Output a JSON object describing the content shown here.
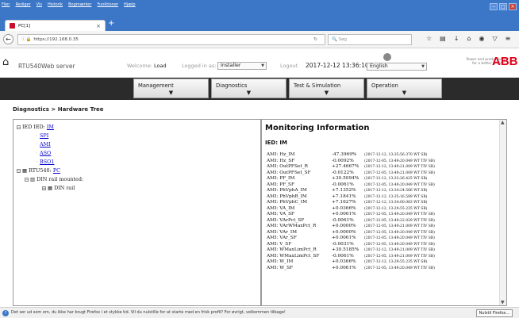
{
  "browser": {
    "menu": [
      "Filer",
      "Rediger",
      "Vis",
      "Historik",
      "Bogmærker",
      "Funktioner",
      "Hjælp"
    ],
    "tab_title": "PC[1]",
    "url": "https://192.168.0.35",
    "search_placeholder": "Søg"
  },
  "app": {
    "title": "RTU540Web server",
    "welcome_label": "Welcome:",
    "welcome_user": "Load",
    "logged_in_label": "Logged in as:",
    "logged_in_value": "Installer",
    "logout_label": "Logout",
    "datetime": "2017-12-12 13:36:10",
    "language": "English",
    "tagline_1": "Power and productivity",
    "tagline_2": "for a better world™",
    "logo": "ABB",
    "brand_color": "#e2001a"
  },
  "menus": [
    {
      "label": "Management"
    },
    {
      "label": "Diagnostics"
    },
    {
      "label": "Test & Simulation"
    },
    {
      "label": "Operation"
    }
  ],
  "breadcrumb": "Diagnostics > Hardware Tree",
  "tree": {
    "ied_prefix": "IED IED:",
    "ied_link": "IM",
    "children": [
      "SPI",
      "AMI",
      "ASO",
      "BSO1"
    ],
    "rtu_prefix": "RTU540:",
    "rtu_link": "PC",
    "din_mounted": "DIN rail mounted:",
    "din_rail": "DIN rail"
  },
  "monitoring": {
    "title": "Monitoring Information",
    "ied_label": "IED: IM",
    "rows": [
      {
        "name": "AMI: Hz_IM",
        "value": "-47.3969%",
        "ts": "(2017-12-12, 13:35:56.370 WT SB)"
      },
      {
        "name": "AMI: Hz_SF",
        "value": "-0.0092%",
        "ts": "(2017-12-05, 13:49:20.049 WT TIV SB)"
      },
      {
        "name": "AMI: OutPFSet_R",
        "value": "+27.4667%",
        "ts": "(2017-12-12, 13:49:21.009 WT TIV SB)"
      },
      {
        "name": "AMI: OutPFSet_SF",
        "value": "-0.0122%",
        "ts": "(2017-12-05, 13:49:21.009 WT TIV SB)"
      },
      {
        "name": "AMI: PF_IM",
        "value": "+30.5094%",
        "ts": "(2017-12-12, 13:33:26.425 WT SB)"
      },
      {
        "name": "AMI: PF_SF",
        "value": "-0.0061%",
        "ts": "(2017-12-05, 13:49:20.049 WT TIV SB)"
      },
      {
        "name": "AMI: PhVphA_IM",
        "value": "+7.1352%",
        "ts": "(2017-12-12, 13:34:24.566 WT SB)"
      },
      {
        "name": "AMI: PhVphB_IM",
        "value": "+7.1841%",
        "ts": "(2017-12-12, 13:35:16.589 WT SB)"
      },
      {
        "name": "AMI: PhVphC_IM",
        "value": "+7.1627%",
        "ts": "(2017-12-12, 13:34:00.083 WT SB)"
      },
      {
        "name": "AMI: VA_IM",
        "value": "+0.0366%",
        "ts": "(2017-12-12, 13:29:55.235 WT SB)"
      },
      {
        "name": "AMI: VA_SF",
        "value": "+0.0061%",
        "ts": "(2017-12-05, 13:49:20.049 WT TIV SB)"
      },
      {
        "name": "AMI: VArPct_SF",
        "value": "-0.0061%",
        "ts": "(2017-12-05, 13:49:22.029 WT TIV SB)"
      },
      {
        "name": "AMI: VArWMaxPct_R",
        "value": "+0.0000%",
        "ts": "(2017-12-05, 13:49:21.009 WT TIV SB)"
      },
      {
        "name": "AMI: VAr_IM",
        "value": "+0.0000%",
        "ts": "(2017-12-05, 13:49:20.049 WT TIV SB)"
      },
      {
        "name": "AMI: VAr_SF",
        "value": "+0.0061%",
        "ts": "(2017-12-05, 13:49:20.049 WT TIV SB)"
      },
      {
        "name": "AMI: V_SF",
        "value": "-0.0031%",
        "ts": "(2017-12-05, 13:49:20.049 WT TIV SB)"
      },
      {
        "name": "AMI: WMaxLimPct_R",
        "value": "+30.5185%",
        "ts": "(2017-12-12, 13:49:21.009 WT TIV SB)"
      },
      {
        "name": "AMI: WMaxLimPct_SF",
        "value": "-0.0061%",
        "ts": "(2017-12-05, 13:49:21.009 WT TIV SB)"
      },
      {
        "name": "AMI: W_IM",
        "value": "+0.0366%",
        "ts": "(2017-12-12, 13:29:55.235 WT SB)"
      },
      {
        "name": "AMI: W_SF",
        "value": "+0.0061%",
        "ts": "(2017-12-05, 13:49:20.049 WT TIV SB)"
      }
    ]
  },
  "notification": {
    "message": "Det ser ud som om, du ikke har brugt Firefox i et stykke tid. Vil du nulstille for at starte med en frisk profil? For øvrigt, velkommen tilbage!",
    "button": "Nulstil Firefox…"
  }
}
